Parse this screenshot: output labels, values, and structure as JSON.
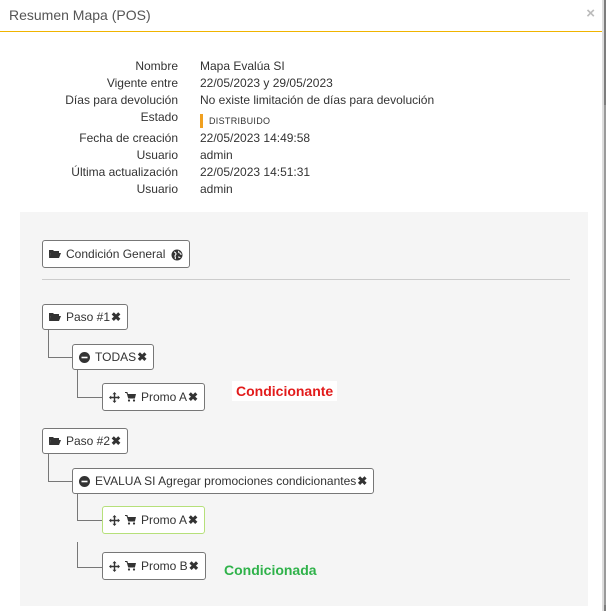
{
  "modal": {
    "title": "Resumen Mapa (POS)",
    "close": "×"
  },
  "info": [
    {
      "label": "Nombre",
      "value": "Mapa Evalúa SI"
    },
    {
      "label": "Vigente entre",
      "value": "22/05/2023 y 29/05/2023"
    },
    {
      "label": "Días para devolución",
      "value": "No existe limitación de días para devolución"
    },
    {
      "label": "Estado",
      "value": "DISTRIBUIDO"
    },
    {
      "label": "Fecha de creación",
      "value": "22/05/2023 14:49:58"
    },
    {
      "label": "Usuario",
      "value": "admin"
    },
    {
      "label": "Última actualización",
      "value": "22/05/2023 14:51:31"
    },
    {
      "label": "Usuario",
      "value": "admin"
    }
  ],
  "tree": {
    "general": "Condición General",
    "paso1": {
      "label": "Paso #1",
      "group": "TODAS",
      "items": [
        "Promo A"
      ]
    },
    "paso2": {
      "label": "Paso #2",
      "group": "EVALUA SI Agregar promociones condicionantes",
      "items": [
        "Promo A",
        "Promo B"
      ]
    }
  },
  "annotations": {
    "condicionante": "Condicionante",
    "condicionada": "Condicionada"
  },
  "colors": {
    "accent": "#f0b400",
    "status": "#f0a020",
    "condicionante": "#e21b1b",
    "condicionada": "#2fb24a",
    "highlight_border": "#b6e07a"
  },
  "icons": {
    "folder": "folder-open-icon",
    "globe": "globe-icon",
    "remove": "remove-icon",
    "minus_circle": "minus-circle-icon",
    "move": "move-icon",
    "cart": "shopping-cart-icon"
  }
}
